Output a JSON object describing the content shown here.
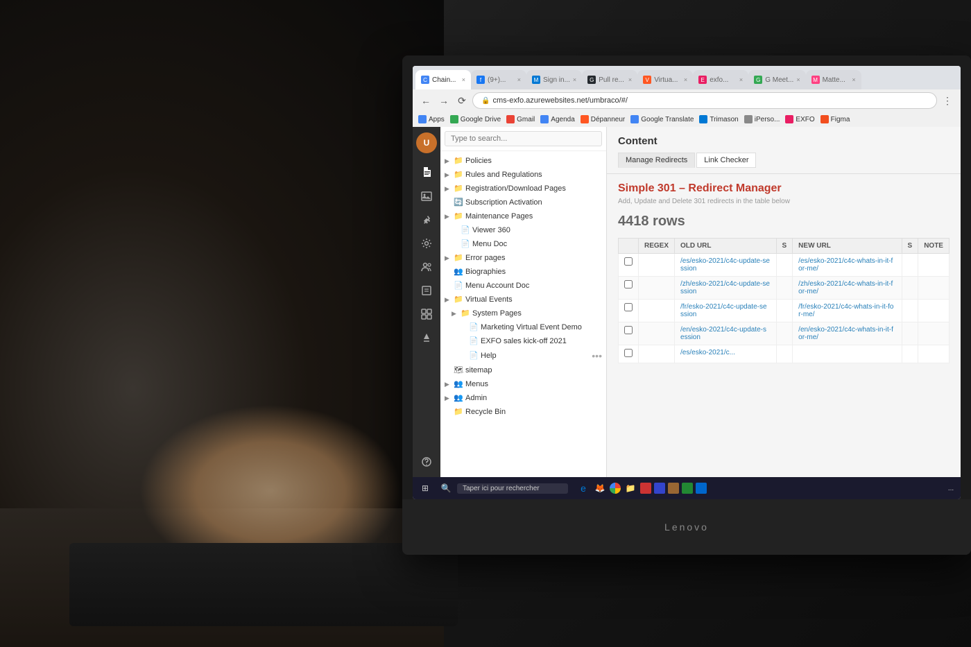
{
  "browser": {
    "tabs": [
      {
        "id": 1,
        "label": "Chain...",
        "active": true,
        "favicon_color": "#4285f4"
      },
      {
        "id": 2,
        "label": "(9+)...",
        "active": false,
        "favicon_color": "#1877f2"
      },
      {
        "id": 3,
        "label": "Sign in...",
        "active": false,
        "favicon_color": "#0078d4"
      },
      {
        "id": 4,
        "label": "Pull re...",
        "active": false,
        "favicon_color": "#24292e"
      },
      {
        "id": 5,
        "label": "Virtua...",
        "active": false,
        "favicon_color": "#ff5722"
      },
      {
        "id": 6,
        "label": "exfo...",
        "active": false,
        "favicon_color": "#e91e63"
      },
      {
        "id": 7,
        "label": "G Meet...",
        "active": false,
        "favicon_color": "#34a853"
      },
      {
        "id": 8,
        "label": "Matte...",
        "active": false,
        "favicon_color": "#ff4081"
      }
    ],
    "address": "cms-exfo.azurewebsites.net/umbraco/#/",
    "bookmarks": [
      {
        "label": "Apps",
        "favicon": "#4285f4"
      },
      {
        "label": "Google Drive",
        "favicon": "#34a853"
      },
      {
        "label": "Gmail",
        "favicon": "#ea4335"
      },
      {
        "label": "Agenda",
        "favicon": "#4285f4"
      },
      {
        "label": "Dépanneur",
        "favicon": "#ff5722"
      },
      {
        "label": "Google Translate",
        "favicon": "#4285f4"
      },
      {
        "label": "Trimason",
        "favicon": "#0078d4"
      },
      {
        "label": "iPerso...",
        "favicon": "#888"
      },
      {
        "label": "EXFO",
        "favicon": "#e91e63"
      },
      {
        "label": "Figma",
        "favicon": "#f24e1e"
      }
    ]
  },
  "cms_sidebar": {
    "logo_text": "U",
    "icons": [
      {
        "name": "document-icon",
        "symbol": "📄"
      },
      {
        "name": "image-icon",
        "symbol": "🖼"
      },
      {
        "name": "tools-icon",
        "symbol": "🔧"
      },
      {
        "name": "settings-icon",
        "symbol": "⚙"
      },
      {
        "name": "person-icon",
        "symbol": "👤"
      },
      {
        "name": "table-icon",
        "symbol": "📊"
      },
      {
        "name": "grid-icon",
        "symbol": "⊞"
      },
      {
        "name": "arrow-icon",
        "symbol": "→"
      },
      {
        "name": "help-icon",
        "symbol": "?"
      }
    ]
  },
  "tree_panel": {
    "search_placeholder": "Type to search...",
    "items": [
      {
        "id": "policies",
        "label": "Policies",
        "level": 0,
        "has_children": true,
        "icon": "folder"
      },
      {
        "id": "rules",
        "label": "Rules and Regulations",
        "level": 0,
        "has_children": true,
        "icon": "folder"
      },
      {
        "id": "registration",
        "label": "Registration/Download Pages",
        "level": 0,
        "has_children": true,
        "icon": "folder"
      },
      {
        "id": "subscription",
        "label": "Subscription Activation",
        "level": 0,
        "has_children": false,
        "icon": "refresh"
      },
      {
        "id": "maintenance",
        "label": "Maintenance Pages",
        "level": 0,
        "has_children": true,
        "icon": "folder"
      },
      {
        "id": "viewer360",
        "label": "Viewer 360",
        "level": 1,
        "has_children": false,
        "icon": "doc"
      },
      {
        "id": "menudoc",
        "label": "Menu Doc",
        "level": 1,
        "has_children": false,
        "icon": "doc"
      },
      {
        "id": "errorpages",
        "label": "Error pages",
        "level": 0,
        "has_children": true,
        "icon": "folder"
      },
      {
        "id": "biographies",
        "label": "Biographies",
        "level": 0,
        "has_children": false,
        "icon": "people"
      },
      {
        "id": "menuaccount",
        "label": "Menu Account Doc",
        "level": 0,
        "has_children": false,
        "icon": "doc"
      },
      {
        "id": "virtualevents",
        "label": "Virtual Events",
        "level": 0,
        "has_children": true,
        "icon": "folder"
      },
      {
        "id": "systempages",
        "label": "System Pages",
        "level": 1,
        "has_children": true,
        "icon": "folder"
      },
      {
        "id": "marketing",
        "label": "Marketing Virtual Event Demo",
        "level": 2,
        "has_children": false,
        "icon": "page"
      },
      {
        "id": "exfosales",
        "label": "EXFO sales kick-off 2021",
        "level": 2,
        "has_children": false,
        "icon": "page"
      },
      {
        "id": "help",
        "label": "Help",
        "level": 2,
        "has_children": false,
        "icon": "doc",
        "show_more": true
      },
      {
        "id": "sitemap",
        "label": "sitemap",
        "level": 0,
        "has_children": false,
        "icon": "sitemap"
      },
      {
        "id": "menus",
        "label": "Menus",
        "level": 0,
        "has_children": true,
        "icon": "people"
      },
      {
        "id": "admin",
        "label": "Admin",
        "level": 0,
        "has_children": true,
        "icon": "people"
      },
      {
        "id": "recyclebin",
        "label": "Recycle Bin",
        "level": 0,
        "has_children": false,
        "icon": "folder"
      }
    ]
  },
  "content": {
    "title": "Content",
    "tabs": [
      {
        "label": "Manage Redirects",
        "active": true
      },
      {
        "label": "Link Checker",
        "active": false
      }
    ],
    "redirect_manager": {
      "title": "Simple 301 – Redirect Manager",
      "subtitle": "Add, Update and Delete 301 redirects in the table below",
      "rows_count": "4418 rows",
      "table_headers": [
        "REGEX",
        "OLD URL",
        "S",
        "NEW URL",
        "S",
        "NOTE"
      ],
      "rows": [
        {
          "checkbox": false,
          "regex": "",
          "old_url": "/es/esko-2021/c4c-update-session",
          "s": "",
          "new_url": "/es/esko-2021/c4c-whats-in-it-for-me/",
          "s2": "",
          "note": ""
        },
        {
          "checkbox": false,
          "regex": "",
          "old_url": "/zh/esko-2021/c4c-update-session",
          "s": "",
          "new_url": "/zh/esko-2021/c4c-whats-in-it-for-me/",
          "s2": "",
          "note": ""
        },
        {
          "checkbox": false,
          "regex": "",
          "old_url": "/fr/esko-2021/c4c-update-session",
          "s": "",
          "new_url": "/fr/esko-2021/c4c-whats-in-it-for-me/",
          "s2": "",
          "note": ""
        },
        {
          "checkbox": false,
          "regex": "",
          "old_url": "/en/esko-2021/c4c-update-session",
          "s": "",
          "new_url": "/en/esko-2021/c4c-whats-in-it-for-me/",
          "s2": "",
          "note": ""
        },
        {
          "checkbox": false,
          "regex": "",
          "old_url": "/es/esko-2021/c...",
          "s": "",
          "new_url": "",
          "s2": "",
          "note": ""
        }
      ]
    }
  },
  "taskbar": {
    "search_text": "Taper ici pour rechercher",
    "time": "..."
  },
  "laptop": {
    "brand": "Lenovo"
  }
}
